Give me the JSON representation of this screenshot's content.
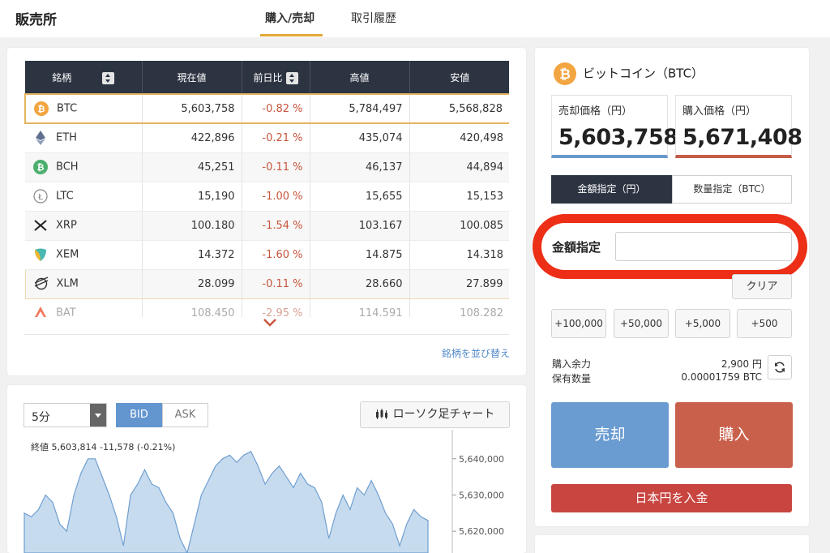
{
  "header": {
    "title": "販売所",
    "tabs": [
      {
        "label": "購入/売却",
        "active": true
      },
      {
        "label": "取引履歴",
        "active": false
      }
    ]
  },
  "market": {
    "columns": [
      "銘柄",
      "現在値",
      "前日比",
      "高値",
      "安値"
    ],
    "rows": [
      {
        "symbol": "BTC",
        "icon": "bitcoin-icon",
        "price": "5,603,758",
        "change": "-0.82 %",
        "high": "5,784,497",
        "low": "5,568,828"
      },
      {
        "symbol": "ETH",
        "icon": "ethereum-icon",
        "price": "422,896",
        "change": "-0.21 %",
        "high": "435,074",
        "low": "420,498"
      },
      {
        "symbol": "BCH",
        "icon": "bitcoin-cash-icon",
        "price": "45,251",
        "change": "-0.11 %",
        "high": "46,137",
        "low": "44,894"
      },
      {
        "symbol": "LTC",
        "icon": "litecoin-icon",
        "price": "15,190",
        "change": "-1.00 %",
        "high": "15,655",
        "low": "15,153"
      },
      {
        "symbol": "XRP",
        "icon": "ripple-icon",
        "price": "100.180",
        "change": "-1.54 %",
        "high": "103.167",
        "low": "100.085"
      },
      {
        "symbol": "XEM",
        "icon": "nem-icon",
        "price": "14.372",
        "change": "-1.60 %",
        "high": "14.875",
        "low": "14.318"
      },
      {
        "symbol": "XLM",
        "icon": "stellar-icon",
        "price": "28.099",
        "change": "-0.11 %",
        "high": "28.660",
        "low": "27.899"
      },
      {
        "symbol": "BAT",
        "icon": "bat-icon",
        "price": "108.450",
        "change": "-2.95 %",
        "high": "114.591",
        "low": "108.282"
      }
    ],
    "sort_link": "銘柄を並び替え"
  },
  "chart": {
    "interval": "5分",
    "sides": [
      "BID",
      "ASK"
    ],
    "candle_button": "ローソク足チャート",
    "info": "終値 5,603,814  -11,578 (-0.21%)"
  },
  "chart_data": {
    "type": "area",
    "y_ticks": [
      "5,640,000",
      "5,630,000",
      "5,620,000"
    ],
    "ylim": [
      5614000,
      5648000
    ],
    "y": [
      5625000,
      5624000,
      5626000,
      5630000,
      5628000,
      5622000,
      5620000,
      5630000,
      5636000,
      5640000,
      5640000,
      5635000,
      5630000,
      5624000,
      5616000,
      5630000,
      5633000,
      5637000,
      5633000,
      5632000,
      5628000,
      5625000,
      5618000,
      5614000,
      5622000,
      5630000,
      5634000,
      5638000,
      5640000,
      5641000,
      5639000,
      5641000,
      5642000,
      5638000,
      5633000,
      5636000,
      5638000,
      5635000,
      5632000,
      5636000,
      5633000,
      5632000,
      5628000,
      5618000,
      5625000,
      5630000,
      5626000,
      5632000,
      5630000,
      5634000,
      5630000,
      5625000,
      5622000,
      5616000,
      5622000,
      5626000,
      5624000,
      5623000
    ]
  },
  "trade": {
    "coin_name": "ビットコイン（BTC）",
    "sell_label": "売却価格（円）",
    "sell_price": "5,603,758",
    "buy_label": "購入価格（円）",
    "buy_price": "5,671,408",
    "mode_yen": "金額指定（円）",
    "mode_btc": "数量指定（BTC）",
    "amount_label": "金額指定",
    "amount_value": "",
    "clear": "クリア",
    "quick": [
      "+100,000",
      "+50,000",
      "+5,000",
      "+500"
    ],
    "balance_label": "購入余力",
    "balance_value": "2,900 円",
    "holding_label": "保有数量",
    "holding_value": "0.00001759 BTC",
    "sell_button": "売却",
    "buy_button": "購入",
    "deposit_button": "日本円を入金"
  },
  "colors": {
    "accent": "#e3a83b",
    "header_dark": "#2c3442",
    "sell_blue": "#6a9bd1",
    "buy_red": "#c9604b",
    "deposit_red": "#c84540",
    "change_red": "#c8553d",
    "highlight_ring": "#ec2f16"
  }
}
